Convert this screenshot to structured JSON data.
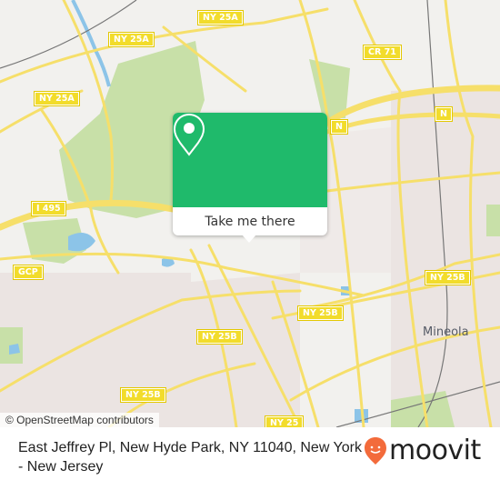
{
  "map": {
    "road_labels": [
      {
        "id": "ny25a-top",
        "text": "NY 25A"
      },
      {
        "id": "ny25a-mid",
        "text": "NY 25A"
      },
      {
        "id": "ny25a-left",
        "text": "NY 25A"
      },
      {
        "id": "cr71",
        "text": "CR 71"
      },
      {
        "id": "n-left",
        "text": "N"
      },
      {
        "id": "n-right",
        "text": "N"
      },
      {
        "id": "i495",
        "text": "I 495"
      },
      {
        "id": "gcp",
        "text": "GCP"
      },
      {
        "id": "ny25b-right",
        "text": "NY 25B"
      },
      {
        "id": "ny25b-center",
        "text": "NY 25B"
      },
      {
        "id": "ny25b-left",
        "text": "NY 25B"
      },
      {
        "id": "ny25b-bottom",
        "text": "NY 25B"
      },
      {
        "id": "ny25",
        "text": "NY 25"
      }
    ],
    "place_labels": [
      {
        "id": "mineola",
        "text": "Mineola"
      }
    ],
    "colors": {
      "background": "#f2f1ee",
      "park": "#c8e0a8",
      "water": "#8cc4e8",
      "road": "#f6df6a",
      "urban": "#ebe4e2",
      "rail": "#777777"
    }
  },
  "attribution": "© OpenStreetMap contributors",
  "popup": {
    "icon": "map-pin-icon",
    "cta_label": "Take me there",
    "accent_color": "#1fba6b"
  },
  "footer": {
    "address": "East Jeffrey Pl, New Hyde Park, NY 11040, New York - New Jersey",
    "brand": "moovit",
    "brand_icon_color": "#f36b3b"
  }
}
